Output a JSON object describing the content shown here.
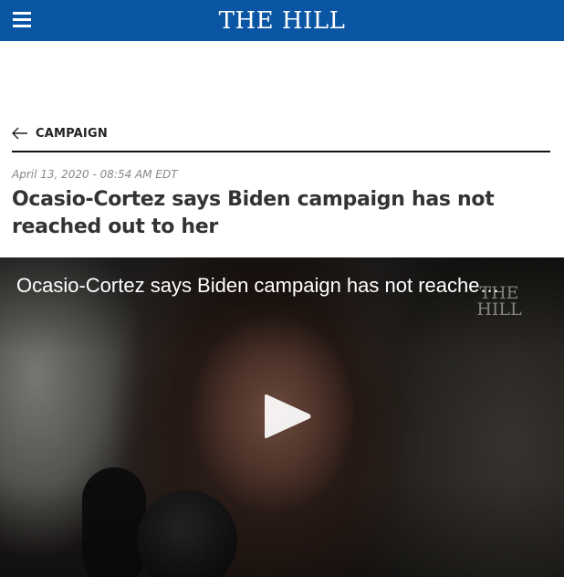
{
  "header": {
    "logo": "THE HILL",
    "menu_icon": "hamburger-menu-icon",
    "background_color": "#0b56a4"
  },
  "article": {
    "section": "CAMPAIGN",
    "back_icon": "arrow-left-icon",
    "dateline": "April 13, 2020 - 08:54 AM EDT",
    "headline": "Ocasio-Cortez says Biden campaign has not reached out to her"
  },
  "video": {
    "title": "Ocasio-Cortez says Biden campaign has not reache…",
    "watermark": "THE HILL",
    "play_icon": "play-icon"
  }
}
